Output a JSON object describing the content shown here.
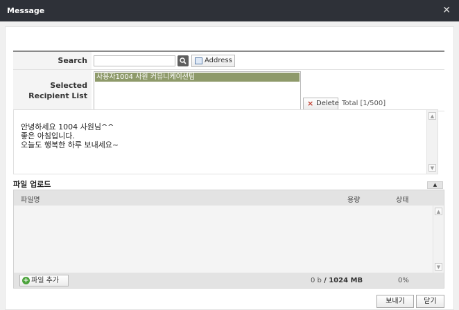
{
  "window": {
    "title": "Message",
    "close_glyph": "✕"
  },
  "search": {
    "label": "Search",
    "value": "",
    "address_label": "Address"
  },
  "recipients": {
    "label": "Selected Recipient List",
    "items": [
      "사용자1004 사원 커뮤니케이션팀"
    ],
    "delete_label": "Delete",
    "total": "Total [1/500]"
  },
  "message": {
    "body": "안녕하세요 1004 사원님^^\n좋은 아침입니다.\n오늘도 행복한 하루 보내세요~"
  },
  "upload": {
    "title": "파일 업로드",
    "columns": {
      "name": "파일명",
      "size": "용량",
      "status": "상태"
    },
    "add_label": "파일 추가",
    "used": "0 b",
    "limit": "/ 1024 MB",
    "percent": "0%"
  },
  "buttons": {
    "send": "보내기",
    "close": "닫기"
  },
  "icons": [
    "close-icon",
    "search-icon",
    "address-book-icon",
    "delete-x-icon",
    "add-file-icon",
    "scroll-up-icon",
    "scroll-down-icon",
    "collapse-icon"
  ],
  "colors": {
    "titlebar": "#2e3138",
    "recipient_highlight": "#8e9a6a",
    "add_icon": "#4aa23a",
    "delete_icon": "#c0392b"
  }
}
